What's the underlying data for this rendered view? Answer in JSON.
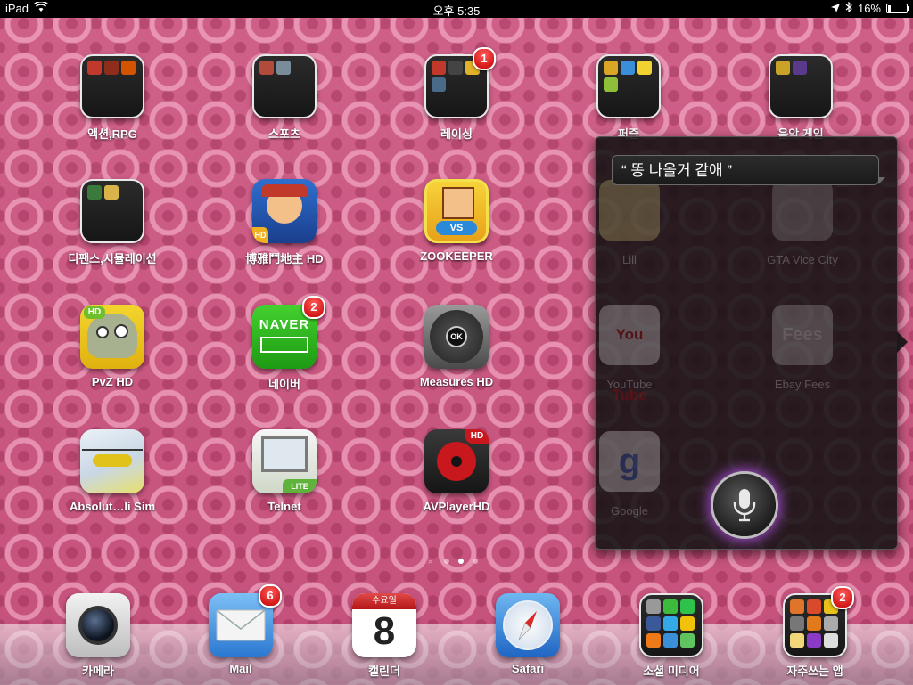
{
  "statusbar": {
    "device": "iPad",
    "time": "오후 5:35",
    "battery_percent": "16%",
    "battery_level": 0.16
  },
  "apps": [
    {
      "label": "액션,RPG",
      "type": "folder",
      "name": "folder-action-rpg"
    },
    {
      "label": "스포츠",
      "type": "folder",
      "name": "folder-sports"
    },
    {
      "label": "레이싱",
      "type": "folder",
      "name": "folder-racing",
      "badge": "1"
    },
    {
      "label": "퍼즐",
      "type": "folder",
      "name": "folder-puzzle"
    },
    {
      "label": "음악 게임",
      "type": "folder",
      "name": "folder-music-game"
    },
    {
      "label": "디팬스,시뮬레이션",
      "type": "folder",
      "name": "folder-defense-sim"
    },
    {
      "label": "博雅鬥地主 HD",
      "type": "app",
      "name": "app-doudizhu"
    },
    {
      "label": "ZOOKEEPER",
      "type": "app",
      "name": "app-zookeeper"
    },
    {
      "label": "PvZ HD",
      "type": "app",
      "name": "app-pvz"
    },
    {
      "label": "네이버",
      "type": "app",
      "name": "app-naver",
      "badge": "2",
      "icon_text": "NAVER"
    },
    {
      "label": "Measures HD",
      "type": "app",
      "name": "app-measures",
      "icon_text": "OK"
    },
    {
      "label": "Absolut…li Sim",
      "type": "app",
      "name": "app-heli-sim"
    },
    {
      "label": "Telnet",
      "type": "app",
      "name": "app-telnet",
      "icon_text": "LITE"
    },
    {
      "label": "AVPlayerHD",
      "type": "app",
      "name": "app-avplayer",
      "icon_text": "HD"
    }
  ],
  "icons": {
    "doudizhu_tag": "HD",
    "pvz_tag": "HD",
    "zookeeper_tag": "VS"
  },
  "dock": [
    {
      "label": "카메라",
      "name": "dock-camera"
    },
    {
      "label": "Mail",
      "name": "dock-mail",
      "badge": "6"
    },
    {
      "label": "캘린더",
      "name": "dock-calendar",
      "weekday": "수요일",
      "day": "8"
    },
    {
      "label": "Safari",
      "name": "dock-safari"
    },
    {
      "label": "소셜 미디어",
      "name": "dock-social-folder"
    },
    {
      "label": "자주쓰는 앱",
      "name": "dock-frequent-folder",
      "badge": "2"
    }
  ],
  "siri": {
    "utterance": "“ 똥 나올거 같애 ”",
    "background_apps": [
      "Lili",
      "GTA Vice City",
      "YouTube",
      "Ebay Fees",
      "Google"
    ],
    "ghost_text": {
      "youtube": "You Tube",
      "fees": "Fees",
      "google": "g"
    },
    "glow_color": "#b052dc"
  },
  "page_indicator": {
    "pages": 3,
    "active_index": 2
  }
}
